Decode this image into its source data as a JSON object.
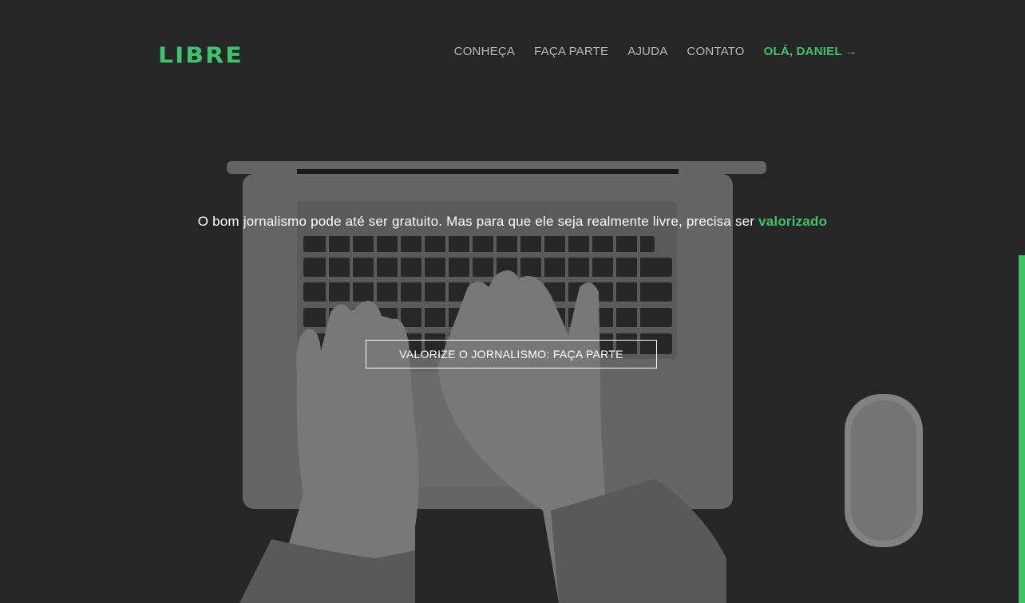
{
  "header": {
    "logo": "LIBRE",
    "nav": [
      {
        "label": "CONHEÇA"
      },
      {
        "label": "FAÇA PARTE"
      },
      {
        "label": "AJUDA"
      },
      {
        "label": "CONTATO"
      }
    ],
    "user_greeting": "OLÁ, DANIEL",
    "user_arrow": "→"
  },
  "hero": {
    "tagline": "O bom jornalismo pode até ser gratuito. Mas para que ele seja realmente livre, precisa ser",
    "tagline_highlight": "valorizado",
    "cta_label": "VALORIZE O JORNALISMO: FAÇA PARTE",
    "background_image": "laptop-typing-photo"
  },
  "colors": {
    "accent": "#3fc36a",
    "background": "#2a2a2a",
    "nav_text": "#b9b9b9"
  }
}
